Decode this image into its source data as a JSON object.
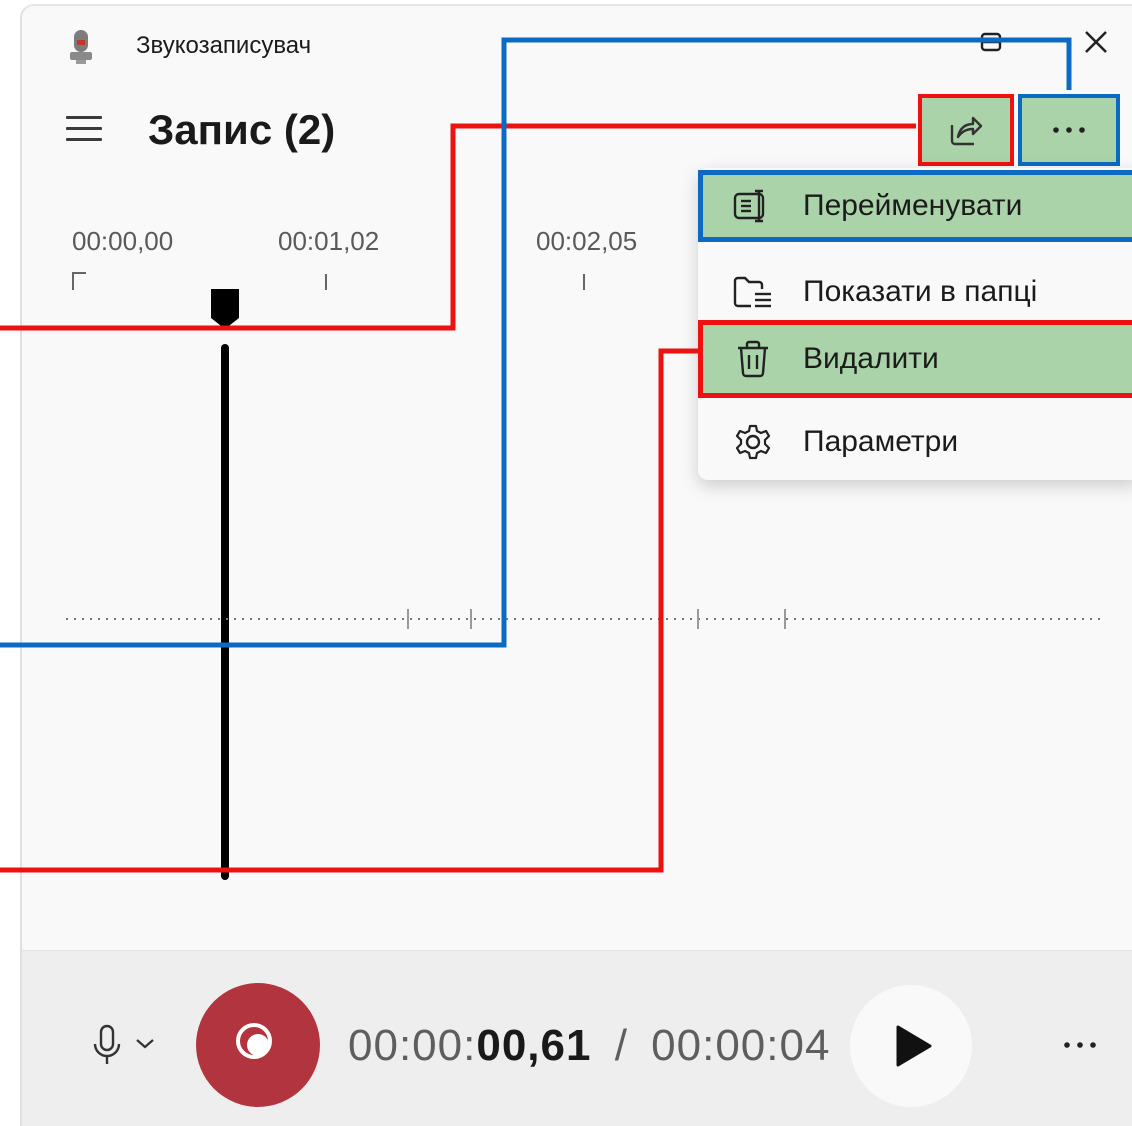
{
  "app": {
    "title": "Звукозаписувач"
  },
  "header": {
    "page_title": "Запис (2)"
  },
  "timeline": {
    "ticks": [
      "00:00,00",
      "00:01,02",
      "00:02,05"
    ]
  },
  "context_menu": {
    "items": [
      {
        "label": "Перейменувати",
        "icon": "rename-icon"
      },
      {
        "label": "Показати в папці",
        "icon": "folder-icon"
      },
      {
        "label": "Видалити",
        "icon": "trash-icon"
      },
      {
        "label": "Параметри",
        "icon": "gear-icon"
      }
    ]
  },
  "playback": {
    "position_prefix": "00:00:",
    "position_bold": "00,61",
    "separator": "/",
    "duration": "00:00:04"
  },
  "colors": {
    "record": "#b2343f",
    "highlight": "#abd3a9",
    "annotation_red": "#ee1111",
    "annotation_blue": "#0b6bc3"
  }
}
